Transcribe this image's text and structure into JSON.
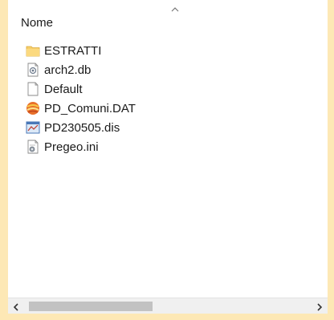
{
  "list": {
    "column_header": "Nome",
    "sort_direction_icon": "chevron-up-icon",
    "items": [
      {
        "name": "ESTRATTI",
        "icon": "folder-icon"
      },
      {
        "name": "arch2.db",
        "icon": "database-file-icon"
      },
      {
        "name": "Default",
        "icon": "blank-file-icon"
      },
      {
        "name": "PD_Comuni.DAT",
        "icon": "dat-file-icon"
      },
      {
        "name": "PD230505.dis",
        "icon": "drawing-file-icon"
      },
      {
        "name": "Pregeo.ini",
        "icon": "settings-file-icon"
      }
    ]
  },
  "scrollbar": {
    "left_arrow": "chevron-left-icon",
    "right_arrow": "chevron-right-icon",
    "thumb_fraction": 0.41
  },
  "colors": {
    "border_accent": "#fde8b5",
    "folder": "#f7cf6b",
    "scroll_track": "#f0f0f0",
    "scroll_thumb": "#c2c2c2"
  }
}
